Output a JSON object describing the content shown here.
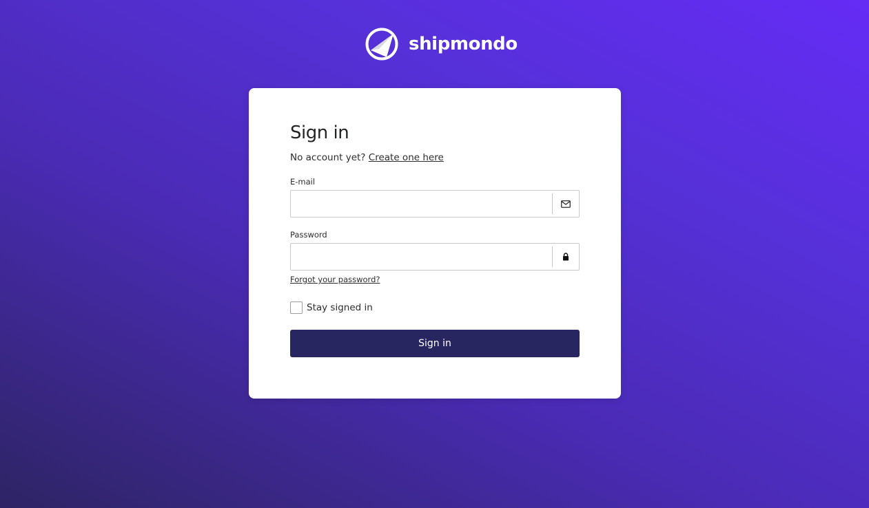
{
  "brand": {
    "name": "shipmondo",
    "logo_icon": "paper-plane-circle-icon"
  },
  "signin": {
    "title": "Sign in",
    "no_account_text": "No account yet?",
    "create_link": "Create one here",
    "email": {
      "label": "E-mail",
      "value": "",
      "placeholder": "",
      "icon": "envelope-icon"
    },
    "password": {
      "label": "Password",
      "value": "",
      "placeholder": "",
      "icon": "lock-icon"
    },
    "forgot_link": "Forgot your password?",
    "stay_signed_in": {
      "label": "Stay signed in",
      "checked": false
    },
    "submit_label": "Sign in"
  },
  "colors": {
    "background_top": "#652cf5",
    "background_bottom": "#2e2464",
    "button": "#272660",
    "card": "#ffffff"
  }
}
